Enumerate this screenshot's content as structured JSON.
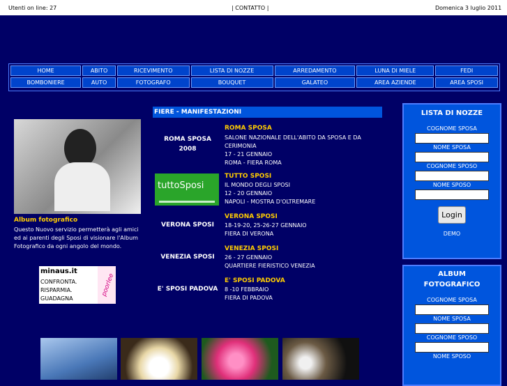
{
  "topbar": {
    "users_online": "Utenti on line: 27",
    "contact": "| CONTATTO |",
    "date": "Domenica 3 luglio 2011"
  },
  "nav": {
    "row1": [
      "HOME",
      "ABITO",
      "RICEVIMENTO",
      "LISTA DI NOZZE",
      "ARREDAMENTO",
      "LUNA DI MIELE",
      "FEDI"
    ],
    "row2": [
      "BOMBONIERE",
      "AUTO",
      "FOTOGRAFO",
      "BOUQUET",
      "GALATEO",
      "AREA AZIENDE",
      "AREA SPOSI"
    ]
  },
  "left": {
    "album_title": "Album fotografico",
    "album_text": "Questo Nuovo servizio permetterà agli amici ed ai parenti degli Sposi di visionare l'Album Fotografico da ogni angolo del mondo.",
    "ad_brand": "minaus.it",
    "ad_lines": [
      "CONFRONTA.",
      "RISPARMIA.",
      "GUADAGNA"
    ],
    "ad_side": "poorlee"
  },
  "fairs": {
    "heading": "FIERE - MANIFESTAZIONI",
    "tutto_logo": "tuttoSposi",
    "items": [
      {
        "left": "ROMA SPOSA\n2008",
        "title": "ROMA SPOSA",
        "lines": [
          "SALONE NAZIONALE DELL'ABITO DA SPOSA E DA CERIMONIA",
          "17 - 21 GENNAIO",
          "ROMA - FIERA ROMA"
        ]
      },
      {
        "left": "",
        "title": "TUTTO SPOSI",
        "lines": [
          "IL MONDO DEGLI SPOSI",
          "12 - 20 GENNAIO",
          "NAPOLI - MOSTRA D'OLTREMARE"
        ]
      },
      {
        "left": "VERONA SPOSI",
        "title": "VERONA SPOSI",
        "lines": [
          "18-19-20, 25-26-27 GENNAIO",
          "FIERA DI VERONA"
        ]
      },
      {
        "left": "VENEZIA SPOSI",
        "title": "VENEZIA SPOSI",
        "lines": [
          "26 - 27 GENNAIO",
          "QUARTIERE FIERISTICO VENEZIA"
        ]
      },
      {
        "left": "E' SPOSI PADOVA",
        "title": "E' SPOSI PADOVA",
        "lines": [
          "8 -10 FEBBRAIO",
          "FIERA DI PADOVA"
        ]
      }
    ]
  },
  "lista_box": {
    "title": "LISTA DI NOZZE",
    "label1": "COGNOME SPOSA",
    "label2": "NOME SPOSA",
    "label3": "COGNOME SPOSO",
    "label4": "NOME SPOSO",
    "login": "Login",
    "demo": "DEMO"
  },
  "album_box": {
    "title": "ALBUM FOTOGRAFICO",
    "label1": "COGNOME SPOSA",
    "label2": "NOME SPOSA",
    "label3": "COGNOME SPOSO",
    "label4": "NOME SPOSO"
  }
}
